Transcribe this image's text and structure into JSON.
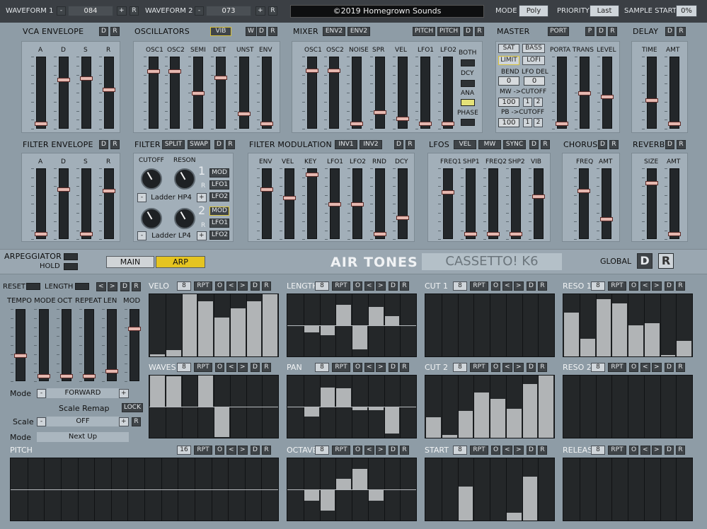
{
  "top": {
    "wf1_label": "WAVEFORM 1",
    "wf1_value": "084",
    "wf2_label": "WAVEFORM 2",
    "wf2_value": "073",
    "copyright": "©2019 Homegrown Sounds",
    "mode_label": "MODE",
    "mode_value": "Poly",
    "priority_label": "PRIORITY",
    "priority_value": "Last",
    "sample_label": "SAMPLE START",
    "sample_value": "0%",
    "r": "R"
  },
  "sections": {
    "vca": "VCA ENVELOPE",
    "osc": "OSCILLATORS",
    "mixer": "MIXER",
    "master": "MASTER",
    "delay": "DELAY",
    "fenv": "FILTER ENVELOPE",
    "filter": "FILTER",
    "fmod": "FILTER MODULATION",
    "lfos": "LFOS",
    "chorus": "CHORUS",
    "reverb": "REVERB",
    "arp": "ARPEGGIATOR",
    "hold": "HOLD"
  },
  "btn": {
    "d": "D",
    "r": "R",
    "w": "W",
    "p": "P",
    "vib": "VIB",
    "env2": "ENV2",
    "pitch": "PITCH",
    "port": "PORT",
    "split": "SPLIT",
    "swap": "SWAP",
    "inv1": "INV1",
    "inv2": "INV2",
    "vel": "VEL",
    "mw": "MW",
    "sync": "SYNC",
    "sat": "SAT",
    "bass": "BASS",
    "limit": "LIMIT",
    "lofi": "LOFI",
    "both": "BOTH",
    "dcy": "DCY",
    "ana": "ANA",
    "phase": "PHASE",
    "mod": "MOD",
    "lfo1": "LFO1",
    "lfo2": "LFO2",
    "one": "1",
    "two": "2",
    "lock": "LOCK",
    "rpt": "RPT",
    "o": "O",
    "lt": "<",
    "gt": ">",
    "minus": "-",
    "plus": "+"
  },
  "labels": {
    "a": "A",
    "d": "D",
    "s": "S",
    "r": "R",
    "osc1": "OSC1",
    "osc2": "OSC2",
    "semi": "SEMI",
    "det": "DET",
    "unst": "UNST",
    "env": "ENV",
    "noise": "NOISE",
    "spr": "SPR",
    "vel": "VEL",
    "lfo1": "LFO1",
    "lfo2": "LFO2",
    "porta": "PORTA TRANS",
    "level": "LEVEL",
    "time": "TIME",
    "amt": "AMT",
    "bend": "BEND",
    "lfodel": "LFO DEL",
    "mwcut": "MW ->CUTOFF",
    "pbcut": "PB ->CUTOFF",
    "cutoff": "CUTOFF",
    "reson": "RESON",
    "key": "KEY",
    "rnd": "RND",
    "dcy": "DCY",
    "freq1": "FREQ1",
    "shp1": "SHP1",
    "freq2": "FREQ2",
    "shp2": "SHP2",
    "vib": "VIB",
    "freq": "FREQ",
    "size": "SIZE"
  },
  "master_vals": {
    "bend": "0",
    "lfodel": "0",
    "mw": "100",
    "pb": "100",
    "one": "1",
    "two": "2"
  },
  "filter": {
    "type1": "Ladder HP4",
    "type2": "Ladder LP4"
  },
  "nav": {
    "main": "MAIN",
    "arp": "ARP",
    "brand": "AIR TONES",
    "model": "CASSETTO! K6",
    "global": "GLOBAL"
  },
  "arp": {
    "reset": "RESET",
    "length": "LENGTH",
    "tempo": "TEMPO MODE",
    "oct": "OCT",
    "repeat": "REPEAT",
    "len": "LEN",
    "mod": "MOD",
    "mode_label": "Mode",
    "mode_value": "FORWARD",
    "scale_remap": "Scale Remap",
    "scale_label": "Scale",
    "scale_value": "OFF",
    "mode2_label": "Mode",
    "mode2_value": "Next Up"
  },
  "seqs": [
    {
      "name": "VELO",
      "count": "8",
      "values": [
        0.03,
        0.1,
        1.0,
        0.89,
        0.63,
        0.77,
        0.89,
        1.0
      ],
      "bipolar": false
    },
    {
      "name": "LENGTH",
      "count": "8",
      "values": [
        0,
        -0.2,
        -0.3,
        0.65,
        -0.75,
        0.6,
        0.3,
        0
      ],
      "bipolar": true
    },
    {
      "name": "CUT 1",
      "count": "8",
      "values": [
        0,
        0,
        0,
        0,
        0,
        0,
        0,
        0
      ],
      "bipolar": false
    },
    {
      "name": "RESO 1",
      "count": "8",
      "values": [
        0.7,
        0.28,
        0.92,
        0.85,
        0.5,
        0.53,
        0.02,
        0.25
      ],
      "bipolar": false
    },
    {
      "name": "WAVES",
      "count": "8",
      "values": [
        1.0,
        0.97,
        0,
        1.0,
        -0.95,
        0,
        0,
        0
      ],
      "bipolar": true
    },
    {
      "name": "PAN",
      "count": "8",
      "values": [
        0,
        -0.3,
        0.62,
        0.58,
        -0.1,
        -0.1,
        -0.85,
        0
      ],
      "bipolar": true
    },
    {
      "name": "CUT 2",
      "count": "8",
      "values": [
        0.33,
        0.05,
        0.43,
        0.73,
        0.63,
        0.47,
        0.86,
        1.0
      ],
      "bipolar": false
    },
    {
      "name": "RESO 2",
      "count": "8",
      "values": [
        0,
        0,
        0,
        0,
        0,
        0,
        0,
        0
      ],
      "bipolar": false
    },
    {
      "name": "PITCH",
      "count": "16",
      "values": [
        0,
        0,
        0,
        0,
        0,
        0,
        0,
        0,
        0,
        0,
        0,
        0,
        0,
        0,
        0,
        0
      ],
      "bipolar": true
    },
    {
      "name": "OCTAVES",
      "count": "8",
      "values": [
        0,
        -0.33,
        -0.66,
        0.33,
        0.66,
        -0.33,
        0,
        0
      ],
      "bipolar": true
    },
    {
      "name": "START",
      "count": "8",
      "values": [
        0,
        0,
        0.55,
        0,
        0,
        0.12,
        0.7,
        0
      ],
      "bipolar": false
    },
    {
      "name": "RELEASE",
      "count": "8",
      "values": [
        0,
        0,
        0,
        0,
        0,
        0,
        0,
        0
      ],
      "bipolar": false
    }
  ],
  "colors": {
    "accent": "#e5c420",
    "panel": "#a2afb9",
    "handle": "#e5b8b0"
  }
}
